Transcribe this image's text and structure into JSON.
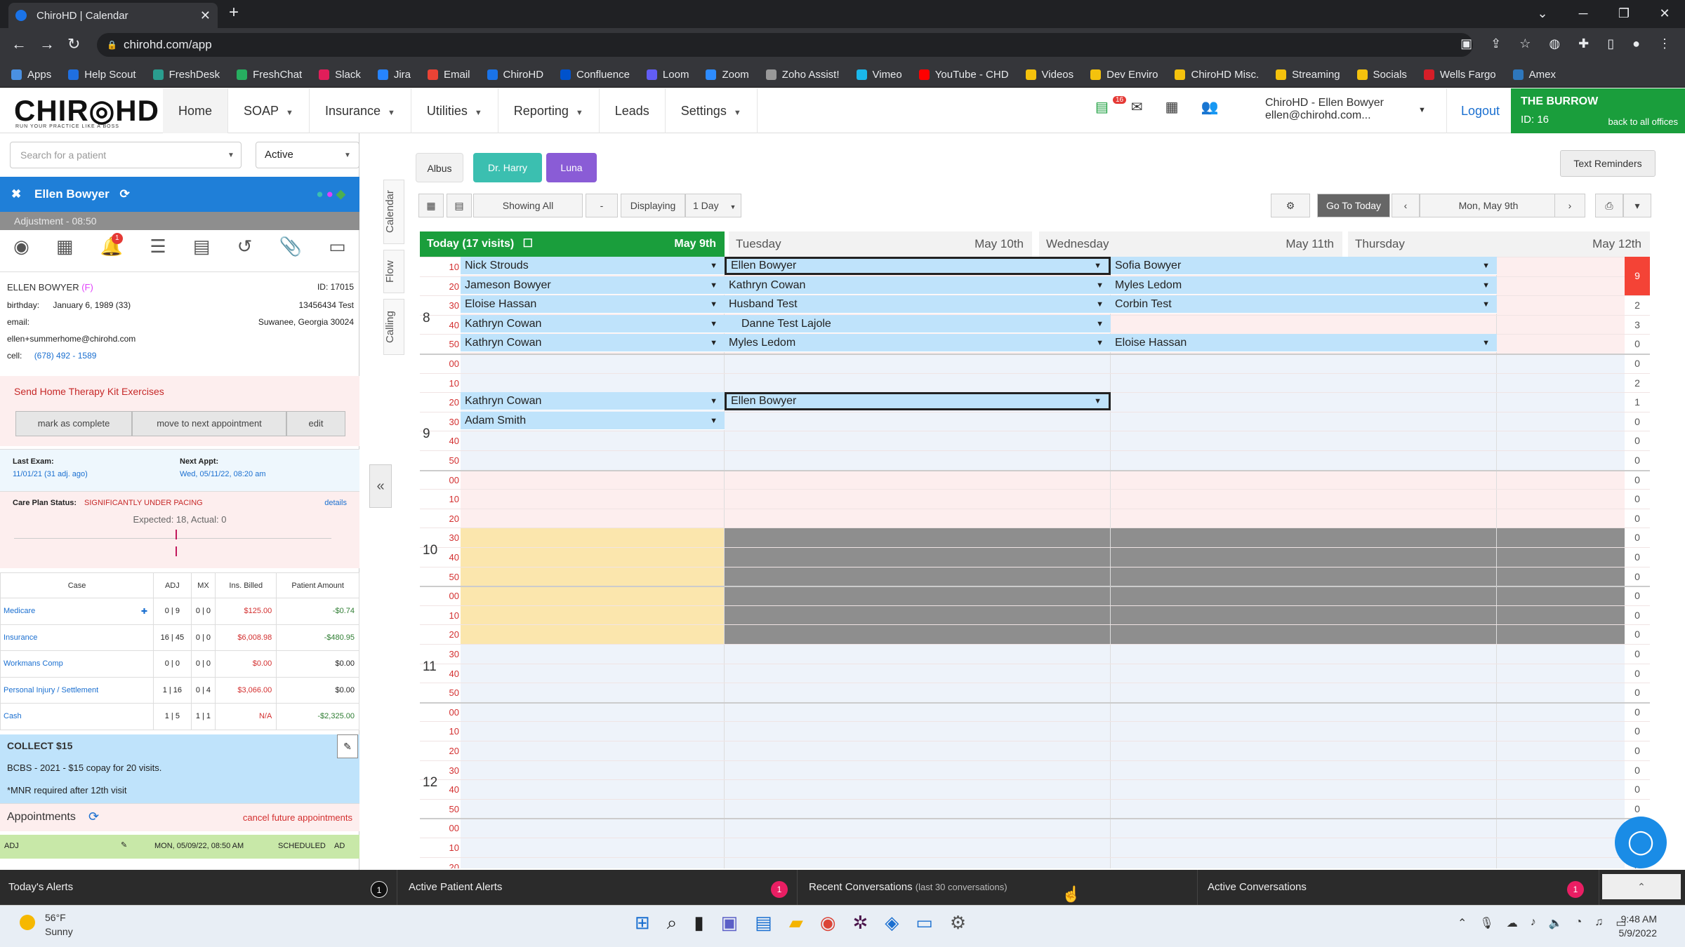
{
  "browser": {
    "tab_title": "ChiroHD | Calendar",
    "url": "chirohd.com/app",
    "bookmarks": [
      {
        "label": "Apps",
        "color": "#4a90e2"
      },
      {
        "label": "Help Scout",
        "color": "#1f6fe0"
      },
      {
        "label": "FreshDesk",
        "color": "#2a9d8f"
      },
      {
        "label": "FreshChat",
        "color": "#27ae60"
      },
      {
        "label": "Slack",
        "color": "#e01e5a"
      },
      {
        "label": "Jira",
        "color": "#2684ff"
      },
      {
        "label": "Email",
        "color": "#ea4335"
      },
      {
        "label": "ChiroHD",
        "color": "#1a73e8"
      },
      {
        "label": "Confluence",
        "color": "#0052cc"
      },
      {
        "label": "Loom",
        "color": "#625df5"
      },
      {
        "label": "Zoom",
        "color": "#2d8cff"
      },
      {
        "label": "Zoho Assist!",
        "color": "#999999"
      },
      {
        "label": "Vimeo",
        "color": "#1ab7ea"
      },
      {
        "label": "YouTube - CHD",
        "color": "#ff0000"
      },
      {
        "label": "Videos",
        "color": "#f4c20d"
      },
      {
        "label": "Dev Enviro",
        "color": "#f4c20d"
      },
      {
        "label": "ChiroHD Misc.",
        "color": "#f4c20d"
      },
      {
        "label": "Streaming",
        "color": "#f4c20d"
      },
      {
        "label": "Socials",
        "color": "#f4c20d"
      },
      {
        "label": "Wells Fargo",
        "color": "#d71e28"
      },
      {
        "label": "Amex",
        "color": "#2e77bc"
      }
    ]
  },
  "header": {
    "logo": "CHIR◎HD",
    "tagline": "RUN YOUR PRACTICE LIKE A BOSS",
    "menu": [
      {
        "label": "Home",
        "caret": false
      },
      {
        "label": "SOAP",
        "caret": true
      },
      {
        "label": "Insurance",
        "caret": true
      },
      {
        "label": "Utilities",
        "caret": true
      },
      {
        "label": "Reporting",
        "caret": true
      },
      {
        "label": "Leads",
        "caret": false
      },
      {
        "label": "Settings",
        "caret": true
      }
    ],
    "notif_count": "16",
    "user_name": "ChiroHD - Ellen Bowyer",
    "user_email": "ellen@chirohd.com...",
    "logout": "Logout",
    "office_name": "THE BURROW",
    "office_id": "ID: 16",
    "back_link": "back to all offices"
  },
  "patient_panel": {
    "search_placeholder": "Search for a patient",
    "status_value": "Active",
    "patient_name": "Ellen Bowyer",
    "adjustment": "Adjustment - 08:50",
    "bell_badge": "1",
    "full_name": "ELLEN BOWYER",
    "sex": "(F)",
    "id": "ID: 17015",
    "birthday_label": "birthday:",
    "birthday": "January 6, 1989 (33)",
    "address_1": "13456434 Test",
    "address_2": "Suwanee, Georgia 30024",
    "email_label": "email:",
    "email": "ellen+summerhome@chirohd.com",
    "cell_label": "cell:",
    "cell": "(678) 492 - 1589",
    "task": "Send Home Therapy Kit Exercises",
    "btn_complete": "mark as complete",
    "btn_move": "move to next appointment",
    "btn_edit": "edit",
    "last_exam_label": "Last Exam:",
    "last_exam": "11/01/21 (31 adj. ago)",
    "next_appt_label": "Next Appt:",
    "next_appt": "Wed, 05/11/22, 08:20 am",
    "care_plan_label": "Care Plan Status:",
    "care_plan_status": "SIGNIFICANTLY UNDER PACING",
    "care_plan_details": "details",
    "care_plan_expected": "Expected: 18, Actual: 0",
    "fin_headers": [
      "Case",
      "ADJ",
      "MX",
      "Ins. Billed",
      "Patient Amount"
    ],
    "fin_rows": [
      {
        "case": "Medicare",
        "adj": "0 | 9",
        "mx": "0 | 0",
        "billed": "$125.00",
        "amount": "-$0.74"
      },
      {
        "case": "Insurance",
        "adj": "16 | 45",
        "mx": "0 | 0",
        "billed": "$6,008.98",
        "amount": "-$480.95"
      },
      {
        "case": "Workmans Comp",
        "adj": "0 | 0",
        "mx": "0 | 0",
        "billed": "$0.00",
        "amount": "$0.00"
      },
      {
        "case": "Personal Injury / Settlement",
        "adj": "1 | 16",
        "mx": "0 | 4",
        "billed": "$3,066.00",
        "amount": "$0.00"
      },
      {
        "case": "Cash",
        "adj": "1 | 5",
        "mx": "1 | 1",
        "billed": "N/A",
        "amount": "-$2,325.00"
      }
    ],
    "collect": "COLLECT $15",
    "collect_note_1": "BCBS - 2021 - $15 copay for 20 visits.",
    "collect_note_2": "*MNR required after 12th visit",
    "appointments_label": "Appointments",
    "cancel_future": "cancel future appointments",
    "appt_row": {
      "type": "ADJ",
      "date": "MON, 05/09/22, 08:50 AM",
      "status": "SCHEDULED",
      "code": "AD"
    }
  },
  "vertical_tabs": [
    "Calendar",
    "Flow",
    "Calling"
  ],
  "calendar": {
    "providers": [
      {
        "label": "Albus",
        "bg": "#f2f2f2",
        "fg": "#333"
      },
      {
        "label": "Dr. Harry",
        "bg": "#3bbfb0",
        "fg": "#fff"
      },
      {
        "label": "Luna",
        "bg": "#8a5cd6",
        "fg": "#fff"
      }
    ],
    "text_reminders": "Text Reminders",
    "showing": "Showing All",
    "displaying_label": "Displaying",
    "displaying_value": "1 Day",
    "go_today": "Go To Today",
    "current_date": "Mon, May 9th",
    "days": [
      {
        "name": "Today (17 visits)",
        "date": "May 9th"
      },
      {
        "name": "Tuesday",
        "date": "May 10th"
      },
      {
        "name": "Wednesday",
        "date": "May 11th"
      },
      {
        "name": "Thursday",
        "date": "May 12th"
      }
    ],
    "hours": [
      "8",
      "9",
      "10",
      "11",
      "12"
    ],
    "minute_labels": [
      "00",
      "10",
      "20",
      "30",
      "40",
      "50"
    ],
    "col1": [
      "Nick Strouds",
      "Jameson Bowyer",
      "Eloise Hassan",
      "Kathryn Cowan",
      "Kathryn Cowan",
      "",
      "",
      "Kathryn Cowan",
      "Adam Smith"
    ],
    "col2": [
      "Ellen Bowyer",
      "Kathryn Cowan",
      "Husband Test",
      "Danne Test Lajole",
      "Myles Ledom",
      "",
      "",
      "Ellen Bowyer",
      ""
    ],
    "col3": [
      "Sofia Bowyer",
      "Myles Ledom",
      "Corbin Test",
      "",
      "Eloise Hassan",
      "",
      "",
      "",
      ""
    ],
    "counts": [
      "9",
      "2",
      "3",
      "0",
      "0",
      "2",
      "1",
      "0",
      "0",
      "0",
      "0",
      "0",
      "0",
      "0",
      "0",
      "0",
      "0",
      "0",
      "0",
      "0",
      "0",
      "0",
      "0",
      "0",
      "0",
      "0",
      "0",
      "0",
      "0",
      "0",
      "0",
      "0",
      "0",
      "0",
      "0"
    ]
  },
  "bottom": {
    "todays_alerts": "Today's Alerts",
    "todays_alerts_count": "1",
    "active_patient_alerts": "Active Patient Alerts",
    "active_patient_alerts_count": "1",
    "recent_conv": "Recent Conversations",
    "recent_conv_note": "(last 30 conversations)",
    "active_conv": "Active Conversations",
    "active_conv_count": "1"
  },
  "taskbar": {
    "temp": "56°F",
    "weather": "Sunny",
    "time": "9:48 AM",
    "date": "5/9/2022"
  }
}
